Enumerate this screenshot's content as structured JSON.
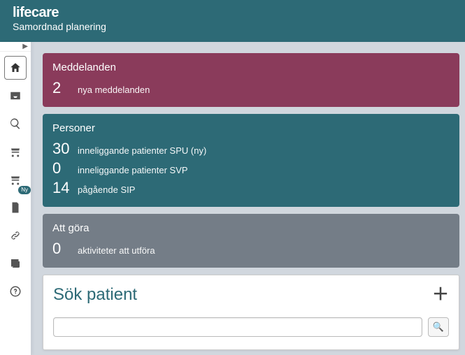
{
  "brand": {
    "logo": "lifecare",
    "subtitle": "Samordnad planering"
  },
  "sidebar": {
    "badge_ny": "Ny"
  },
  "cards": {
    "meddelanden": {
      "title": "Meddelanden",
      "count": "2",
      "label": "nya meddelanden"
    },
    "personer": {
      "title": "Personer",
      "rows": [
        {
          "count": "30",
          "label": "inneliggande patienter SPU (ny)"
        },
        {
          "count": "0",
          "label": "inneliggande patienter SVP"
        },
        {
          "count": "14",
          "label": "pågående SIP"
        }
      ]
    },
    "attgora": {
      "title": "Att göra",
      "count": "0",
      "label": "aktiviteter att utföra"
    }
  },
  "search": {
    "title": "Sök patient",
    "value": "",
    "placeholder": ""
  }
}
